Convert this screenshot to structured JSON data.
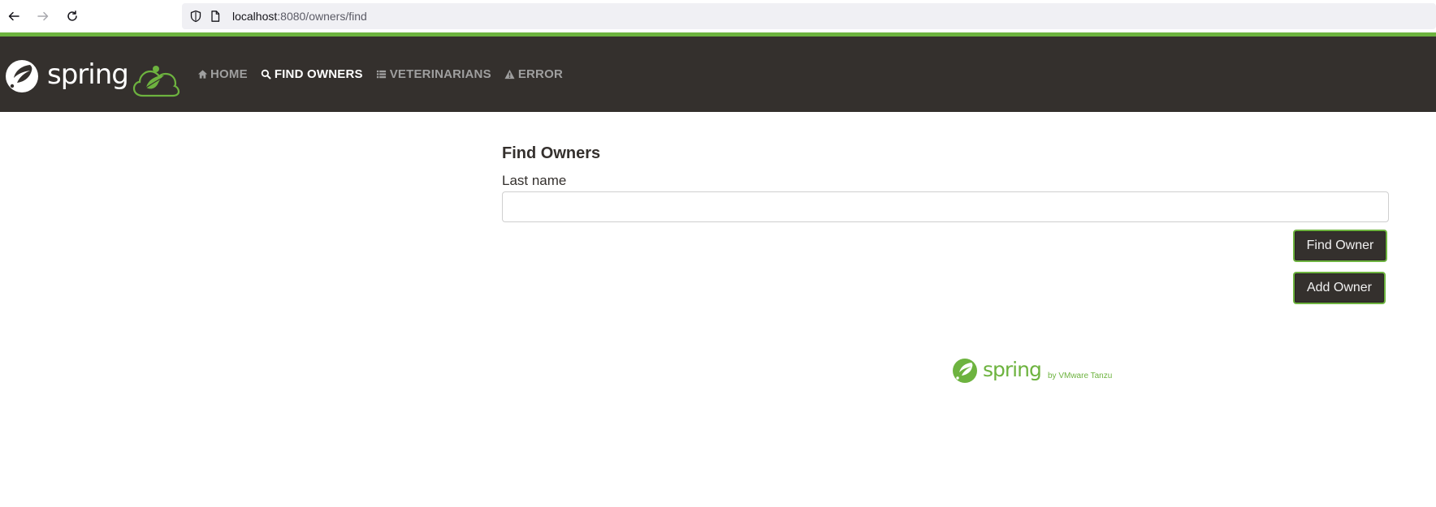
{
  "browser": {
    "url_host": "localhost",
    "url_path": ":8080/owners/find"
  },
  "brand": {
    "logo_text": "spring",
    "colors": {
      "green": "#6db33f",
      "dark": "#34302d"
    }
  },
  "nav": {
    "items": [
      {
        "label": "HOME",
        "icon": "home-icon",
        "active": false
      },
      {
        "label": "FIND OWNERS",
        "icon": "search-icon",
        "active": true
      },
      {
        "label": "VETERINARIANS",
        "icon": "list-icon",
        "active": false
      },
      {
        "label": "ERROR",
        "icon": "warning-icon",
        "active": false
      }
    ]
  },
  "main": {
    "title": "Find Owners",
    "last_name_label": "Last name",
    "last_name_value": "",
    "find_button": "Find Owner",
    "add_button": "Add Owner"
  },
  "footer": {
    "logo_text": "spring",
    "tagline": "by VMware Tanzu"
  }
}
